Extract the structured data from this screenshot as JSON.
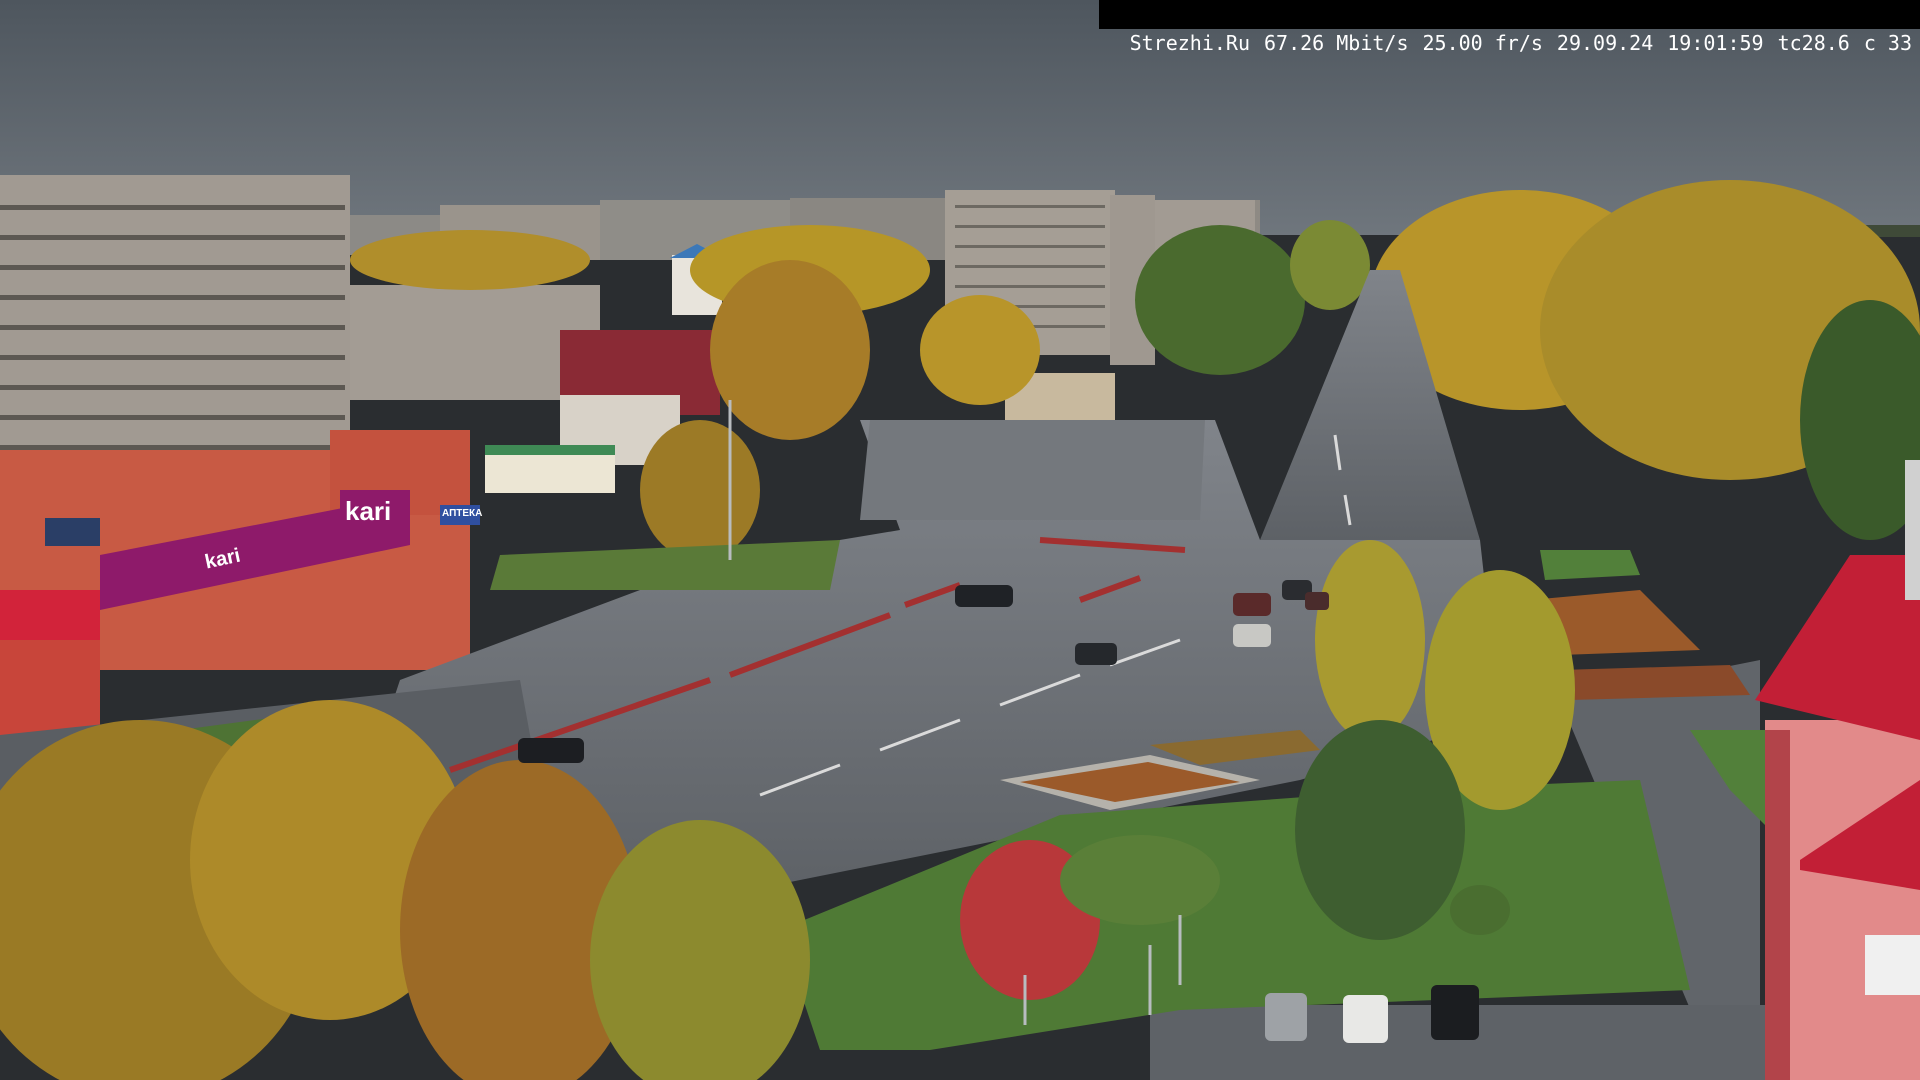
{
  "osd": {
    "site": "Strezhi.Ru",
    "bitrate": "67.26 Mbit/s",
    "framerate": "25.00 fr/s",
    "date": "29.09.24",
    "time": "19:01:59",
    "temperature": "tc28.6",
    "camera": "c 33"
  },
  "signs": {
    "store_brand": "kari",
    "store_brand_secondary": "kari",
    "pharmacy": "АПТЕКА"
  },
  "colors": {
    "sky": "#5b636b",
    "asphalt": "#6c7075",
    "grass": "#4f7a35",
    "foliage_yellow": "#b8952a",
    "store_magenta": "#8e1a6a",
    "roof_red": "#c21f36"
  }
}
